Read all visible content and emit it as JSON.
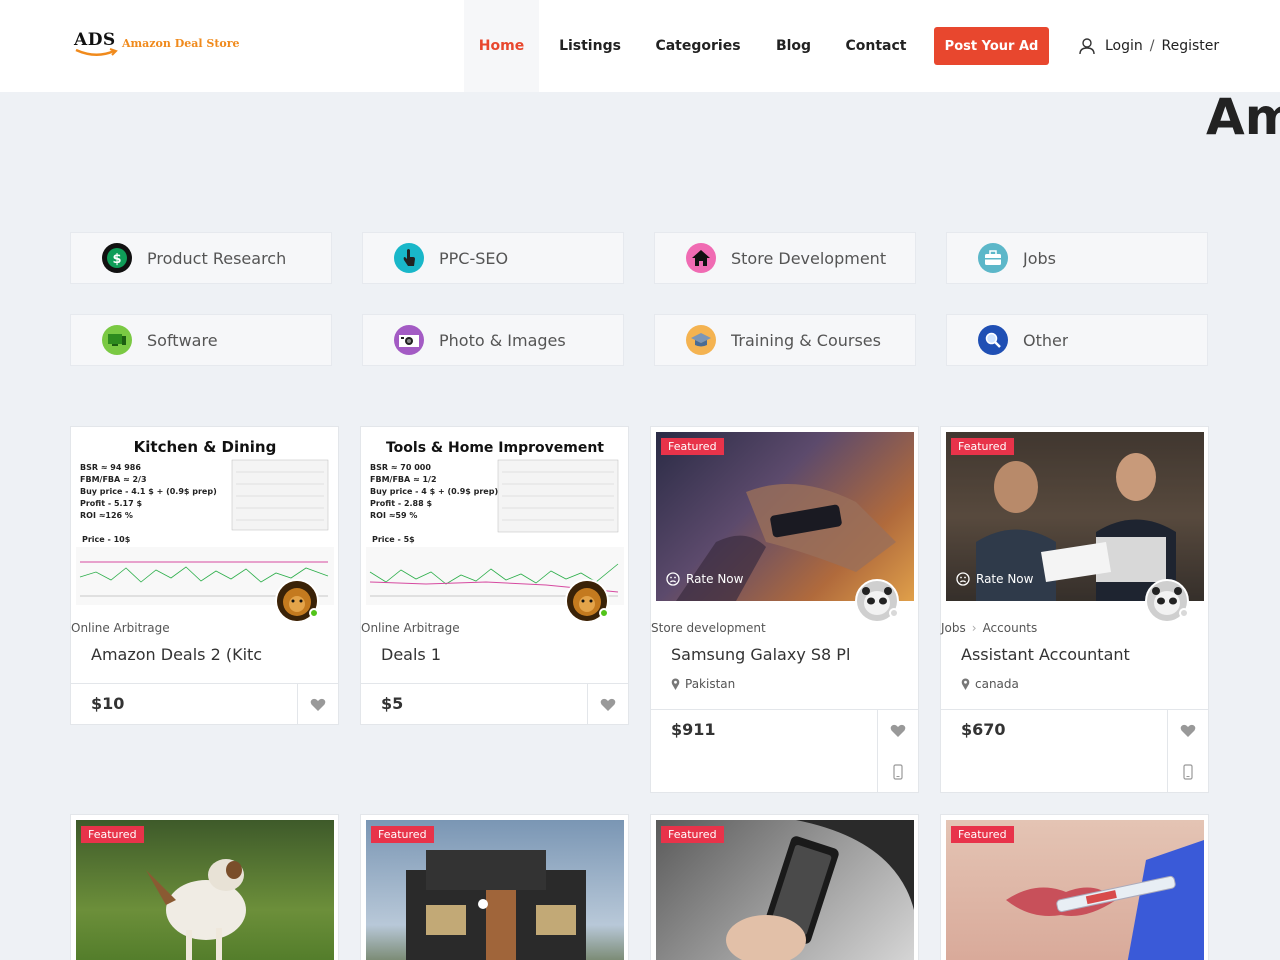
{
  "header": {
    "logo": {
      "mark": "ADS",
      "name": "Amazon Deal Store"
    },
    "nav": [
      {
        "label": "Home",
        "active": true
      },
      {
        "label": "Listings"
      },
      {
        "label": "Categories"
      },
      {
        "label": "Blog"
      },
      {
        "label": "Contact"
      }
    ],
    "post_button": "Post Your Ad",
    "login": "Login",
    "separator": "/",
    "register": "Register"
  },
  "hero": {
    "text": "Am"
  },
  "categories": [
    {
      "label": "Product Research",
      "icon": "dollar-icon",
      "color": "#0f9d58"
    },
    {
      "label": "PPC-SEO",
      "icon": "hand-click-icon",
      "color": "#19b7c9"
    },
    {
      "label": "Store Development",
      "icon": "store-icon",
      "color": "#f06bb3"
    },
    {
      "label": "Jobs",
      "icon": "briefcase-icon",
      "color": "#5cb7c9"
    },
    {
      "label": "Software",
      "icon": "monitor-icon",
      "color": "#7ac943"
    },
    {
      "label": "Photo & Images",
      "icon": "camera-icon",
      "color": "#a35bc4"
    },
    {
      "label": "Training & Courses",
      "icon": "graduation-icon",
      "color": "#f4b351"
    },
    {
      "label": "Other",
      "icon": "search-icon",
      "color": "#1f4fb4"
    }
  ],
  "listings": [
    {
      "category": "Online Arbitrage",
      "title": "Amazon Deals 2 (Kitc",
      "price": "$10",
      "image": {
        "heading": "Kitchen & Dining",
        "lines": [
          "BSR ≈ 94 986",
          "FBM/FBA ≈ 2/3",
          "Buy price - 4.1 $ + (0.9$ prep)",
          "Profit - 5.17 $",
          "ROI ≈126 %"
        ],
        "price_line": "Price - 10$"
      }
    },
    {
      "category": "Online Arbitrage",
      "title": "Deals 1",
      "price": "$5",
      "image": {
        "heading": "Tools & Home Improvement",
        "lines": [
          "BSR ≈ 70 000",
          "FBM/FBA ≈ 1/2",
          "Buy price - 4 $ + (0.9$ prep)",
          "Profit - 2.88 $",
          "ROI ≈59 %"
        ],
        "price_line": "Price - 5$"
      }
    },
    {
      "badge": "Featured",
      "rate": "Rate Now",
      "category": "Store development",
      "title": "Samsung Galaxy S8 Pl",
      "location": "Pakistan",
      "price": "$911"
    },
    {
      "badge": "Featured",
      "rate": "Rate Now",
      "category": "Jobs",
      "subcategory": "Accounts",
      "title": "Assistant Accountant",
      "location": "canada",
      "price": "$670"
    }
  ],
  "bottom_row": [
    {
      "badge": "Featured"
    },
    {
      "badge": "Featured"
    },
    {
      "badge": "Featured"
    },
    {
      "badge": "Featured"
    }
  ]
}
